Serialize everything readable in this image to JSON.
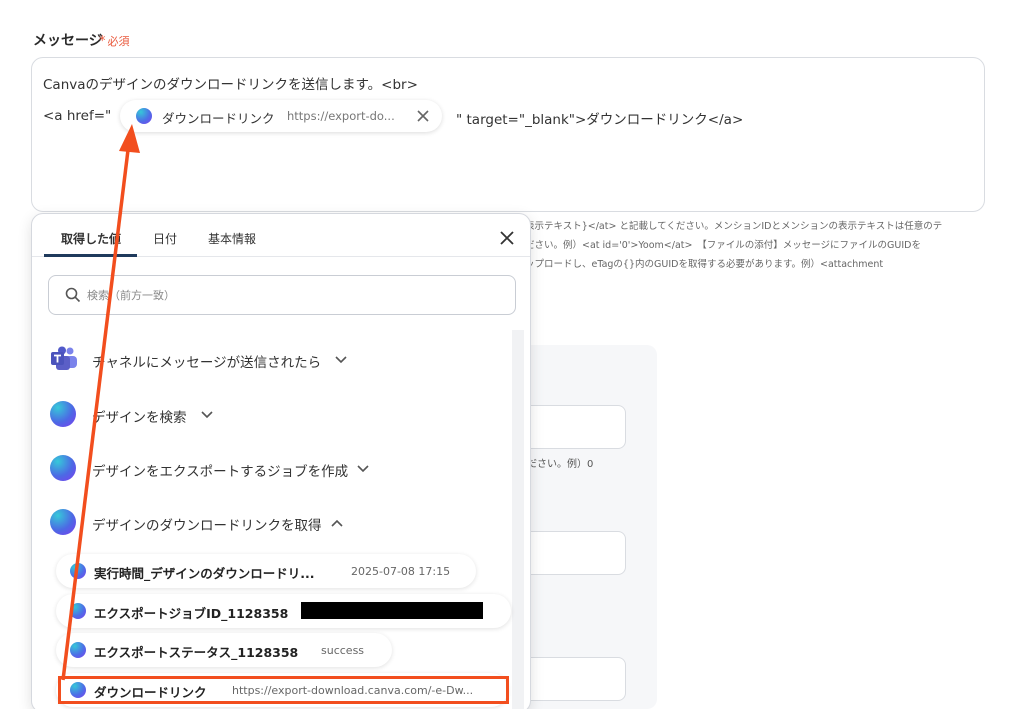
{
  "field": {
    "label": "メッセージ",
    "required": "必須"
  },
  "editor": {
    "line1": "Canvaのデザインのダウンロードリンクを送信します。<br>",
    "anchor_prefix": "<a href=\"",
    "anchor_suffix": "\" target=\"_blank\">ダウンロードリンク</a>",
    "chip": {
      "icon": "canva-icon",
      "label": "ダウンロードリンク",
      "value": "https://export-do..."
    }
  },
  "help_lines": [
    "表示テキスト}</at> と記載してください。メンションIDとメンションの表示テキストは任意のテ",
    "ださい。例）<at id='0'>Yoom</at>　【ファイルの添付】メッセージにファイルのGUIDを",
    "ップロードし、eTagの{}内のGUIDを取得する必要があります。例）<attachment"
  ],
  "bg_text": "ださい。例）0",
  "popup": {
    "tabs": [
      "取得した値",
      "日付",
      "基本情報"
    ],
    "active_tab": 0,
    "search_placeholder": "検索（前方一致）",
    "groups": [
      {
        "icon": "teams-icon",
        "label": "チャネルにメッセージが送信されたら",
        "expanded": false
      },
      {
        "icon": "canva-icon",
        "label": "デザインを検索",
        "expanded": false
      },
      {
        "icon": "canva-icon",
        "label": "デザインをエクスポートするジョブを作成",
        "expanded": false
      },
      {
        "icon": "canva-icon",
        "label": "デザインのダウンロードリンクを取得",
        "expanded": true
      }
    ],
    "items": [
      {
        "label": "実行時間_デザインのダウンロードリ...",
        "value": "2025-07-08 17:15"
      },
      {
        "label": "エクスポートジョブID_1128358",
        "value": "[redacted]"
      },
      {
        "label": "エクスポートステータス_1128358",
        "value": "success"
      },
      {
        "label": "ダウンロードリンク",
        "value": "https://export-download.canva.com/-e-Dw..."
      }
    ]
  },
  "colors": {
    "accent": "#1f3a5c",
    "required": "#e9593d",
    "annotation": "#f24e1e"
  }
}
